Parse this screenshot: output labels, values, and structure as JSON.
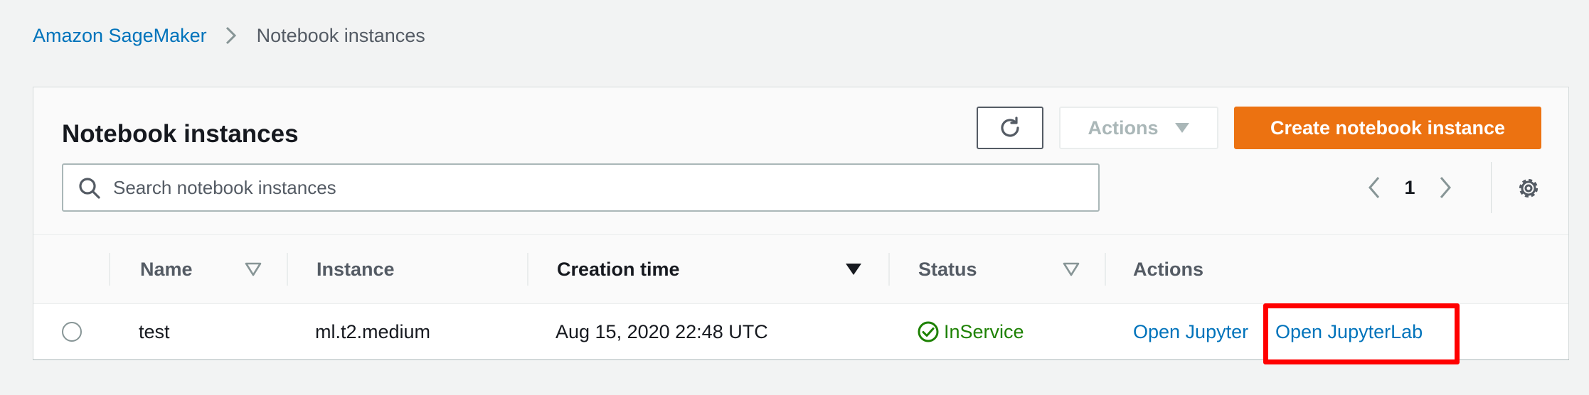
{
  "breadcrumb": {
    "root": "Amazon SageMaker",
    "current": "Notebook instances"
  },
  "panel": {
    "title": "Notebook instances",
    "refresh_icon": "refresh-icon",
    "actions_label": "Actions",
    "create_label": "Create notebook instance"
  },
  "search": {
    "placeholder": "Search notebook instances",
    "value": ""
  },
  "pagination": {
    "current_page": "1"
  },
  "table": {
    "columns": {
      "name": "Name",
      "instance": "Instance",
      "creation_time": "Creation time",
      "status": "Status",
      "actions": "Actions"
    },
    "rows": [
      {
        "name": "test",
        "instance": "ml.t2.medium",
        "creation_time": "Aug 15, 2020 22:48 UTC",
        "status": "InService",
        "open_jupyter": "Open Jupyter",
        "open_jupyterlab": "Open JupyterLab"
      }
    ]
  },
  "colors": {
    "accent_orange": "#ec7211",
    "link_blue": "#0073bb",
    "status_green": "#1d8102",
    "highlight_red": "#ff0000"
  }
}
